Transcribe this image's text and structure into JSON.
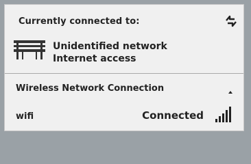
{
  "header": {
    "title": "Currently connected to:",
    "refresh_icon": "refresh-icon"
  },
  "network": {
    "name": "Unidentified network",
    "access": "Internet access",
    "icon": "bench-network-icon"
  },
  "section": {
    "title": "Wireless Network Connection",
    "collapse_icon": "collapse-arrow-icon"
  },
  "connection": {
    "name": "wifi",
    "status": "Connected",
    "signal_bars": 5,
    "signal_icon": "signal-strength-icon"
  },
  "colors": {
    "panel": "#f0f0f0",
    "text": "#222222",
    "backdrop": "#9aa1a6"
  }
}
